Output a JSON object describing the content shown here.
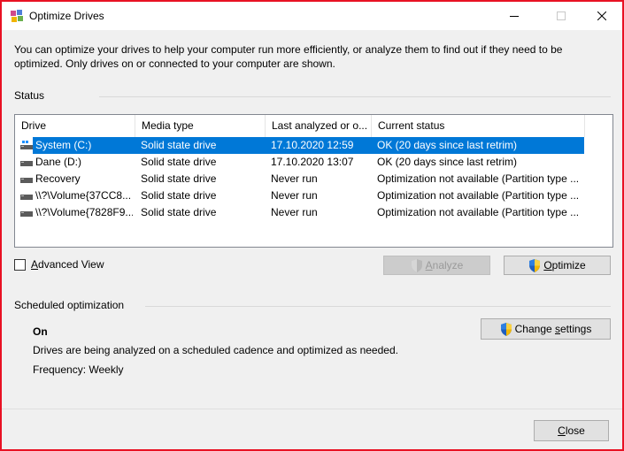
{
  "window": {
    "title": "Optimize Drives",
    "accent": "#e81123",
    "icon": "defrag-app-icon"
  },
  "intro": {
    "text": "You can optimize your drives to help your computer run more efficiently, or analyze them to find out if they need to be optimized. Only drives on or connected to your computer are shown."
  },
  "status": {
    "label": "Status",
    "columns": [
      "Drive",
      "Media type",
      "Last analyzed or o...",
      "Current status"
    ],
    "rows": [
      {
        "drive": "System (C:)",
        "media": "Solid state drive",
        "last": "17.10.2020 12:59",
        "status": "OK (20 days since last retrim)",
        "selected": true
      },
      {
        "drive": "Dane (D:)",
        "media": "Solid state drive",
        "last": "17.10.2020 13:07",
        "status": "OK (20 days since last retrim)",
        "selected": false
      },
      {
        "drive": "Recovery",
        "media": "Solid state drive",
        "last": "Never run",
        "status": "Optimization not available (Partition type ...",
        "selected": false
      },
      {
        "drive": "\\\\?\\Volume{37CC8...",
        "media": "Solid state drive",
        "last": "Never run",
        "status": "Optimization not available (Partition type ...",
        "selected": false
      },
      {
        "drive": "\\\\?\\Volume{7828F9...",
        "media": "Solid state drive",
        "last": "Never run",
        "status": "Optimization not available (Partition type ...",
        "selected": false
      }
    ],
    "selection_color": "#0078d7"
  },
  "controls": {
    "advanced_view_label": "Advanced View",
    "advanced_view_checked": false,
    "analyze_label": "Analyze",
    "analyze_enabled": false,
    "optimize_label": "Optimize"
  },
  "scheduled": {
    "label": "Scheduled optimization",
    "state": "On",
    "description": "Drives are being analyzed on a scheduled cadence and optimized as needed.",
    "frequency": "Frequency: Weekly",
    "change_settings_label": "Change settings"
  },
  "footer": {
    "close_label": "Close"
  }
}
